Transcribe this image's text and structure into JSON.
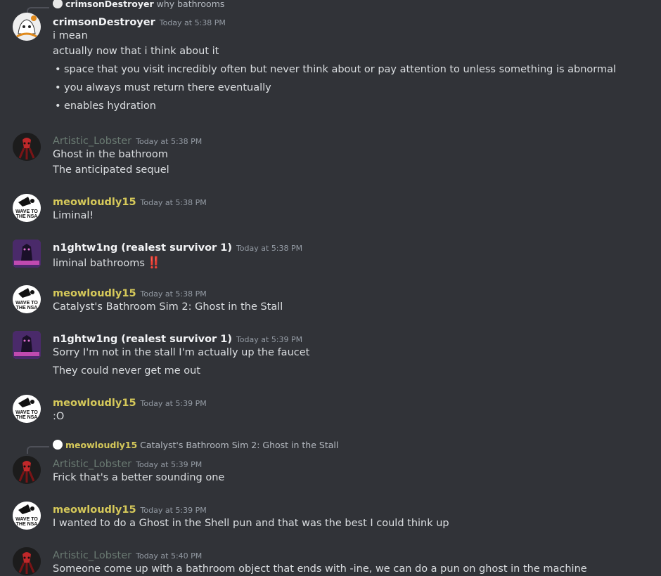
{
  "colors": {
    "crimson": "#f2f3f5",
    "lobster": "#6a7a72",
    "meowl": "#d6c95a",
    "night": "#f2f3f5"
  },
  "messages": [
    {
      "reply": {
        "author": "crimsonDestroyer",
        "text": "why bathrooms"
      },
      "author": "crimsonDestroyer",
      "timestamp": "Today at 5:38 PM",
      "lines": [
        "i mean",
        "actually now that i think about it"
      ],
      "bullets": [
        "space that you visit incredibly often but never think about or pay attention to unless something is abnormal",
        "you always must return there eventually",
        "enables hydration"
      ]
    },
    {
      "author": "Artistic_Lobster",
      "timestamp": "Today at 5:38 PM",
      "lines": [
        "Ghost in the bathroom",
        "The anticipated sequel"
      ]
    },
    {
      "author": "meowloudly15",
      "timestamp": "Today at 5:38 PM",
      "lines": [
        "Liminal!"
      ]
    },
    {
      "author": "n1ghtw1ng (realest survivor 1)",
      "timestamp": "Today at 5:38 PM",
      "lines": [
        "liminal bathrooms"
      ],
      "emoji": "‼️"
    },
    {
      "author": "meowloudly15",
      "timestamp": "Today at 5:38 PM",
      "lines": [
        "Catalyst's Bathroom Sim 2: Ghost in the Stall"
      ]
    },
    {
      "author": "n1ghtw1ng (realest survivor 1)",
      "timestamp": "Today at 5:39 PM",
      "lines": [
        "Sorry I'm not in the stall I'm actually up the faucet",
        "They could never get me out"
      ]
    },
    {
      "author": "meowloudly15",
      "timestamp": "Today at 5:39 PM",
      "lines": [
        ":O"
      ]
    },
    {
      "reply": {
        "author": "meowloudly15",
        "text": "Catalyst's Bathroom Sim 2: Ghost in the Stall"
      },
      "author": "Artistic_Lobster",
      "timestamp": "Today at 5:39 PM",
      "lines": [
        "Frick that's a better sounding one"
      ]
    },
    {
      "author": "meowloudly15",
      "timestamp": "Today at 5:39 PM",
      "lines": [
        "I wanted to do a Ghost in the Shell pun and that was the best I could think up"
      ]
    },
    {
      "author": "Artistic_Lobster",
      "timestamp": "Today at 5:40 PM",
      "lines": [
        "Someone come up with a bathroom object that ends with -ine, we can do a pun on ghost in the machine"
      ]
    }
  ],
  "avatar_text": {
    "wave": "WAVE TO",
    "nsa": "THE NSA"
  }
}
